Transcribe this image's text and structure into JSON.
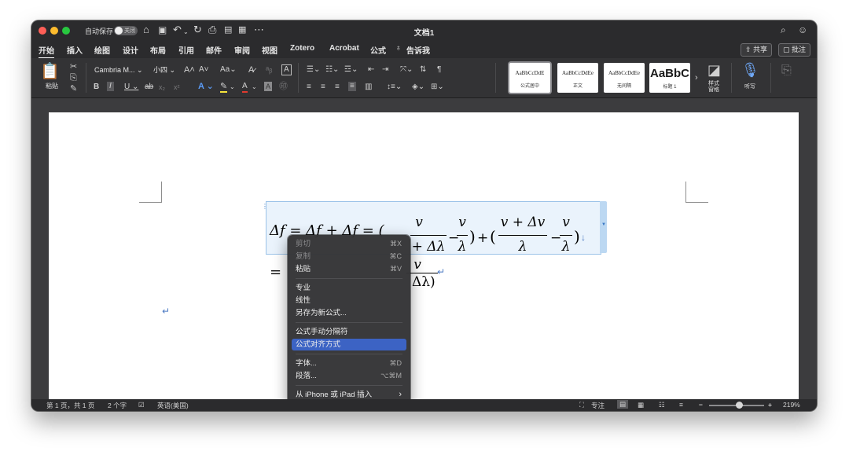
{
  "window": {
    "doc_title": "文档1",
    "autosave_label": "自动保存",
    "autosave_state": "关闭"
  },
  "menubar": {
    "items": [
      "开始",
      "插入",
      "绘图",
      "设计",
      "布局",
      "引用",
      "邮件",
      "审阅",
      "视图",
      "Zotero",
      "Acrobat",
      "公式"
    ],
    "tell_me": "告诉我",
    "share": "共享",
    "comments": "批注"
  },
  "ribbon": {
    "paste": "粘贴",
    "font_name": "Cambria M...",
    "font_size": "小四",
    "styles": [
      {
        "sample": "AaBbCcDdE",
        "name": "公式居中"
      },
      {
        "sample": "AaBbCcDdEe",
        "name": "正文"
      },
      {
        "sample": "AaBbCcDdEe",
        "name": "无间隔"
      },
      {
        "sample": "AaBbC",
        "name": "标题 1"
      }
    ],
    "styles_pane": "样式\n窗格",
    "dictate": "听写"
  },
  "equation": {
    "lhs": "Δf",
    "line1_visible": "Δf = Δf  + Δf  = (",
    "line2_start": "= ",
    "line2_end": "Δλ)",
    "frac1_num": "v",
    "frac1_den": "+ Δλ",
    "frac2_num": "v",
    "frac2_den": "λ",
    "frac3_num": "v + Δv",
    "frac3_den": "λ",
    "frac4_num": "v",
    "frac4_den": "λ",
    "line2_num": "v"
  },
  "context_menu": {
    "items": [
      {
        "label": "剪切",
        "shortcut": "⌘X",
        "disabled": true
      },
      {
        "label": "复制",
        "shortcut": "⌘C",
        "disabled": true
      },
      {
        "label": "粘贴",
        "shortcut": "⌘V",
        "disabled": false
      },
      {
        "label": "专业",
        "shortcut": "",
        "disabled": false
      },
      {
        "label": "线性",
        "shortcut": "",
        "disabled": false
      },
      {
        "label": "另存为新公式...",
        "shortcut": "",
        "disabled": false
      },
      {
        "label": "公式手动分隔符",
        "shortcut": "",
        "disabled": false
      },
      {
        "label": "公式对齐方式",
        "shortcut": "",
        "disabled": false,
        "highlighted": true
      },
      {
        "label": "字体...",
        "shortcut": "⌘D",
        "disabled": false
      },
      {
        "label": "段落...",
        "shortcut": "⌥⌘M",
        "disabled": false
      },
      {
        "label": "从 iPhone 或 iPad 插入",
        "shortcut": "›",
        "disabled": false
      }
    ]
  },
  "statusbar": {
    "page": "第 1 页，共 1 页",
    "words": "2 个字",
    "language": "英语(美国)",
    "focus": "专注",
    "zoom": "219%"
  }
}
